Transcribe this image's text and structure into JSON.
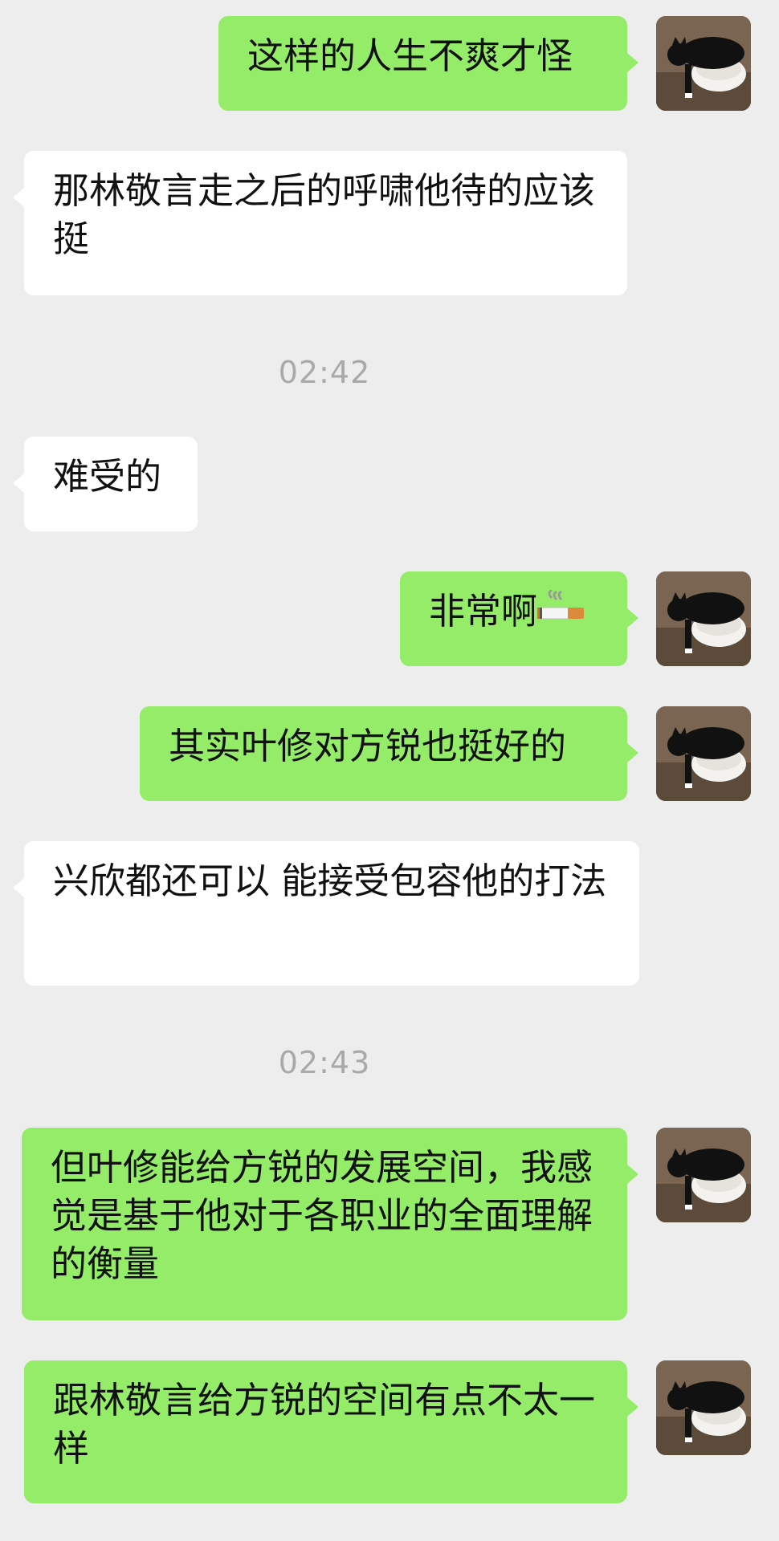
{
  "messages": [
    {
      "id": "m1",
      "side": "out",
      "text": "这样的人生不爽才怪"
    },
    {
      "id": "m2",
      "side": "in",
      "text": "那林敬言走之后的呼啸他待的应该挺"
    },
    {
      "id": "t1",
      "side": "time",
      "text": "02:42"
    },
    {
      "id": "m3",
      "side": "in",
      "text": "难受的"
    },
    {
      "id": "m4",
      "side": "out",
      "text": "非常啊",
      "emoji": "cigarette-emoji"
    },
    {
      "id": "m5",
      "side": "out",
      "text": "其实叶修对方锐也挺好的"
    },
    {
      "id": "m6",
      "side": "in",
      "text": "兴欣都还可以 能接受包容他的打法"
    },
    {
      "id": "t2",
      "side": "time",
      "text": "02:43"
    },
    {
      "id": "m7",
      "side": "out",
      "text": "但叶修能给方锐的发展空间，我感觉是基于他对于各职业的全面理解的衡量"
    },
    {
      "id": "m8",
      "side": "out",
      "text": "跟林敬言给方锐的空间有点不太一样"
    }
  ],
  "colors": {
    "background": "#ededed",
    "outgoing_bubble": "#95ec69",
    "incoming_bubble": "#ffffff",
    "timestamp_text": "#a9a9a9"
  },
  "icons": {
    "avatar": "black-white-cat-on-toilet-avatar",
    "emoji": "cigarette-emoji"
  }
}
